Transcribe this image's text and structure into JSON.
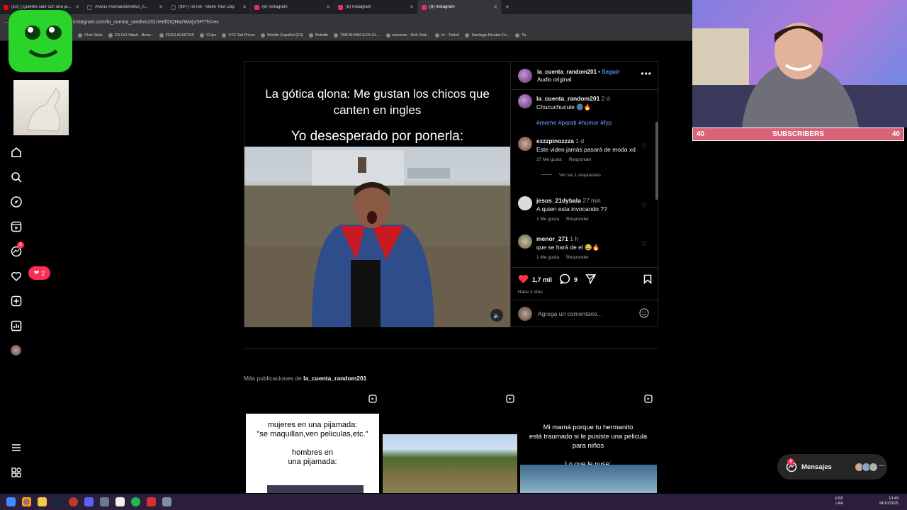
{
  "browser": {
    "tabs": [
      {
        "title": "(10) ¿Quieres salir con una jap...",
        "color": "#ff0000"
      },
      {
        "title": "#nivus #somautomotivo_n...",
        "color": "#000000"
      },
      {
        "title": "(99+) TikTok - Make Your Day",
        "color": "#000000"
      },
      {
        "title": "(8) Instagram",
        "color": "#e1306c"
      },
      {
        "title": "(8) Instagram",
        "color": "#e1306c"
      },
      {
        "title": "(8) Instagram",
        "color": "#e1306c",
        "active": true
      }
    ],
    "new_tab": "+",
    "url": "instagram.com/la_cuenta_random201/reel/DQHa2WwjV5P/?hl=es",
    "bookmarks": [
      "Chat Stats",
      "CS:GO Stash - Brow...",
      "FEED ALERTAS",
      "CLips",
      "STC Set Prices",
      "Wordle Español (ES)",
      "Bolsdle",
      "TAN BIONICA EN EL...",
      "sionaron - Kick Stat...",
      "trr - Twitch",
      "Santiago Nicolas Fe...",
      "Ta"
    ]
  },
  "nav": {
    "notifications_count": "2",
    "messages_badge": "8"
  },
  "post": {
    "username": "la_cuenta_random201",
    "follow": "Seguir",
    "separator": " • ",
    "audio": "Audio original",
    "caption_line1": "La gótica qlona: Me gustan los chicos que",
    "caption_line2": "canten en ingles",
    "caption_line3": "Yo desesperado por ponerla:",
    "description": {
      "user": "la_cuenta_random201",
      "time": "2 d",
      "text": "Chucuchucule 🌚🔥",
      "tags": "#meme #parati #humor #fyp"
    },
    "comments": [
      {
        "user": "ezzzpinozzza",
        "time": "1 d",
        "text": "Este video jamás pasará de moda xd",
        "likes": "37 Me gusta",
        "reply": "Responder",
        "replies": "Ver las 1 respuestas"
      },
      {
        "user": "jesus_21dybala",
        "time": "27 min",
        "text": "A quien esta invocando ??",
        "likes": "1 Me gusta",
        "reply": "Responder"
      },
      {
        "user": "menor_271",
        "time": "1 h",
        "text": "que se hará de el 😂🔥",
        "likes": "1 Me gusta",
        "reply": "Responder"
      }
    ],
    "likes_count": "1,7 mil",
    "comments_count": "9",
    "posted_ago": "Hace 2 días",
    "add_comment_placeholder": "Agrega un comentario..."
  },
  "more_posts": {
    "label": "Más publicaciones de ",
    "user": "la_cuenta_random201",
    "thumbs": [
      {
        "text": "mujeres en una pijamada:\n\"se maquillan,ven peliculas,etc.\"\n\nhombres en\nuna pijamada:"
      },
      {
        "text": ""
      },
      {
        "text": "Mi mamá:porque tu hermanito\nestá traumado si le pusiste una pelicula\npara  niños\n\nLo que le puse:"
      }
    ]
  },
  "stream": {
    "subs_left": "40",
    "subs_label": "SUBSCRIBERS",
    "subs_right": "40"
  },
  "messages": {
    "label": "Mensajes",
    "badge": "8"
  },
  "taskbar": {
    "lang_top": "ESP",
    "lang_bottom": "LAA",
    "time": "13:49",
    "date": "24/10/2025"
  },
  "colors": {
    "accent": "#4a9cff",
    "like": "#ff3040",
    "badge": "#ff2d55",
    "subs_bar": "#d9647a"
  }
}
